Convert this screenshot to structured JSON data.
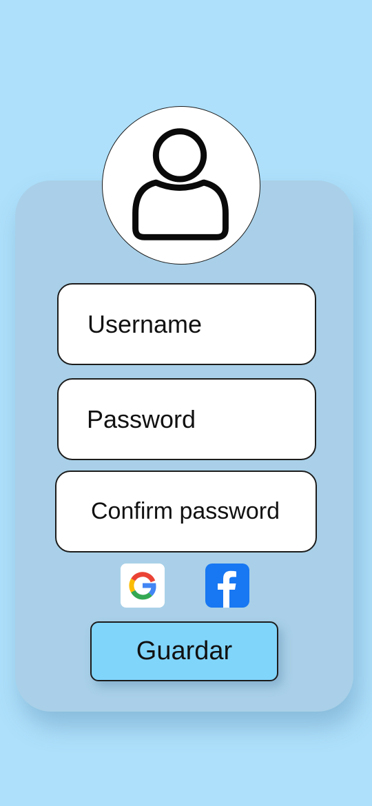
{
  "form": {
    "username_label": "Username",
    "password_label": "Password",
    "confirm_label": "Confirm password",
    "save_label": "Guardar"
  },
  "social": {
    "google_icon": "google-logo",
    "facebook_icon": "facebook-logo"
  },
  "colors": {
    "background": "#aee0fb",
    "card": "#a9d0e8",
    "button": "#80d5fb",
    "facebook_blue": "#1877f2"
  }
}
